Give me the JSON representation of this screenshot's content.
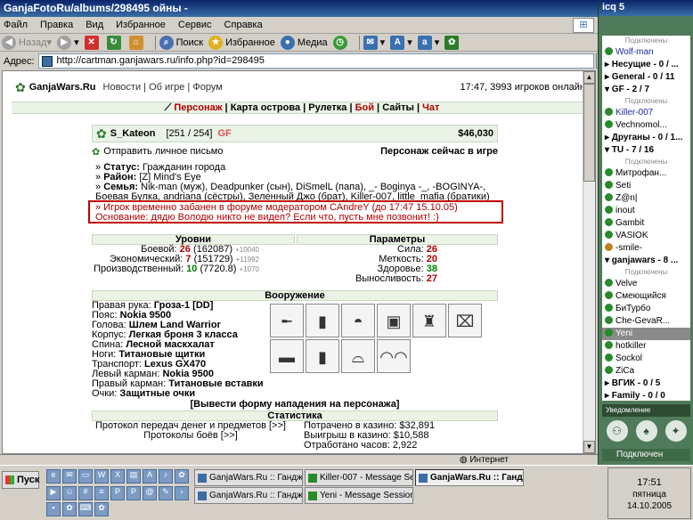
{
  "ie": {
    "title": "GanjaFotoRu/albums/298495",
    "title_suffix": " ойны -",
    "menu": [
      "Файл",
      "Правка",
      "Вид",
      "Избранное",
      "Сервис",
      "Справка"
    ],
    "toolbar": {
      "back": "Назад",
      "search": "Поиск",
      "favorites": "Избранное",
      "media": "Медиа"
    },
    "address_label": "Адрес:",
    "url": "http://cartman.ganjawars.ru/info.php?id=298495",
    "status_zone": "Интернет"
  },
  "site": {
    "brand": "GanjaWars.Ru",
    "nav": "Новости | Об игре | Форум",
    "online": "17:47, 3993 игроков онлайн",
    "nav2_person": "Персонаж",
    "nav2_map": "Карта острова",
    "nav2_roulette": "Рулетка",
    "nav2_fight": "Бой",
    "nav2_sites": "Сайты",
    "nav2_chat": "Чат"
  },
  "player": {
    "name": "S_Kateon",
    "hp": "[251 / 254]",
    "badge": "GF",
    "money": "$46,030",
    "send_mail": "Отправить личное письмо",
    "in_game": "Персонаж сейчас в игре",
    "status_label": "Статус:",
    "status": "Гражданин города",
    "district_label": "Район:",
    "district": "[Z] Mind's Eye",
    "family_label": "Семья:",
    "family": "Nik-man (муж), Deadpunker (сын), DiSmelL (папа), _- Boginya -_, -BOGINYA-, Боевая Булка, andriana (сёстры), Зеленный Джо (брат), Killer-007, little_mafia (братики)"
  },
  "ban": {
    "line1": "» Игрок временно забанен в форуме модератором CAndreY (до 17:47 15.10.05)",
    "line2": "Основание: дядю Володю никто не видел? Если что, пусть мне позвонит! :)"
  },
  "levels": {
    "title": "Уровни",
    "rows": [
      {
        "label": "Боевой:",
        "value": "26",
        "extra": "(162087)",
        "small": "+10040"
      },
      {
        "label": "Экономический:",
        "value": "7",
        "extra": "(151729)",
        "small": "+11992"
      },
      {
        "label": "Производственный:",
        "value": "10",
        "extra": "(7720.8)",
        "small": "+1070"
      }
    ]
  },
  "params": {
    "title": "Параметры",
    "rows": [
      {
        "label": "Сила:",
        "value": "26"
      },
      {
        "label": "Меткость:",
        "value": "20"
      },
      {
        "label": "Здоровье:",
        "value": "38"
      },
      {
        "label": "Выносливость:",
        "value": "27"
      }
    ]
  },
  "equipment": {
    "title": "Вооружение",
    "rows": [
      {
        "slot": "Правая рука:",
        "item": "Гроза-1 [DD]"
      },
      {
        "slot": "Пояс:",
        "item": "Nokia 9500"
      },
      {
        "slot": "Голова:",
        "item": "Шлем Land Warrior"
      },
      {
        "slot": "Корпус:",
        "item": "Легкая броня 3 класса"
      },
      {
        "slot": "Спина:",
        "item": "Лесной маскхалат"
      },
      {
        "slot": "Ноги:",
        "item": "Титановые щитки"
      },
      {
        "slot": "Транспорт:",
        "item": "Lexus GX470"
      },
      {
        "slot": "Левый карман:",
        "item": "Nokia 9500"
      },
      {
        "slot": "Правый карман:",
        "item": "Титановые вставки"
      },
      {
        "slot": "Очки:",
        "item": "Защитные очки"
      }
    ],
    "icons": [
      "rifle-icon",
      "phone-icon",
      "helmet-icon",
      "armor-icon",
      "camo-icon",
      "shin-guard-icon",
      "car-icon",
      "phone-icon",
      "insert-icon",
      "glasses-icon"
    ]
  },
  "attack_link": "[Вывести форму нападения на персонажа]",
  "stats": {
    "title": "Статистика",
    "left1": "Протокол передач денег и предметов [>>]",
    "left2": "Протоколы боёв [>>]",
    "right1": "Потрачено в казино: $32,891",
    "right2": "Выигрыш в казино: $10,588",
    "right3": "Отработано часов: 2,922"
  },
  "icq": {
    "title": "icq 5",
    "entries": [
      {
        "kind": "label",
        "text": "Подключены"
      },
      {
        "kind": "ct",
        "text": "Wolf-man",
        "cls": "blue"
      },
      {
        "kind": "grp",
        "text": "▸ Несущие - 0 / ..."
      },
      {
        "kind": "grp",
        "text": "▸ General - 0 / 11"
      },
      {
        "kind": "grp",
        "text": "▾ GF - 2 / 7"
      },
      {
        "kind": "label",
        "text": "Подключены"
      },
      {
        "kind": "ct",
        "text": "Killer-007",
        "cls": "blue"
      },
      {
        "kind": "ct",
        "text": "Vechnomol...",
        "cls": ""
      },
      {
        "kind": "grp",
        "text": "▸ Друганы - 0 / 1..."
      },
      {
        "kind": "grp",
        "text": "▾ TU - 7 / 16"
      },
      {
        "kind": "label",
        "text": "Подключены"
      },
      {
        "kind": "ct",
        "text": "Митрофан...",
        "cls": ""
      },
      {
        "kind": "ct",
        "text": "Seti",
        "cls": ""
      },
      {
        "kind": "ct",
        "text": "Z@n|",
        "cls": ""
      },
      {
        "kind": "ct",
        "text": "inout",
        "cls": ""
      },
      {
        "kind": "ct",
        "text": "Gambit",
        "cls": ""
      },
      {
        "kind": "ct",
        "text": "VASIOK",
        "cls": ""
      },
      {
        "kind": "ct",
        "text": "-smile-",
        "cls": "away"
      },
      {
        "kind": "grp",
        "text": "▾ ganjawars - 8 ..."
      },
      {
        "kind": "label",
        "text": "Подключены"
      },
      {
        "kind": "ct",
        "text": "Velve",
        "cls": ""
      },
      {
        "kind": "ct",
        "text": "Смеющийся",
        "cls": ""
      },
      {
        "kind": "ct",
        "text": "БиТурбо",
        "cls": ""
      },
      {
        "kind": "ct",
        "text": "Che-GevaR...",
        "cls": ""
      },
      {
        "kind": "ct",
        "text": "Yeni",
        "cls": "sel"
      },
      {
        "kind": "ct",
        "text": "hotkiller",
        "cls": ""
      },
      {
        "kind": "ct",
        "text": "Sockol",
        "cls": ""
      },
      {
        "kind": "ct",
        "text": "ZiCa",
        "cls": ""
      },
      {
        "kind": "grp",
        "text": "▸ ВГИК - 0 / 5"
      },
      {
        "kind": "grp",
        "text": "▸ Family - 0 / 0"
      }
    ],
    "notify": "Уведомление",
    "status": "Подключен"
  },
  "taskbar": {
    "start": "Пуск",
    "tasks": [
      {
        "label": "GanjaWars.Ru :: Гандж...",
        "active": false
      },
      {
        "label": "Killer-007 - Message Ses...",
        "active": false
      },
      {
        "label": "GanjaWars.Ru :: Гандж...",
        "active": true
      },
      {
        "label": "GanjaWars.Ru :: Гандж...",
        "active": false
      },
      {
        "label": "Yeni - Message Session (...",
        "active": false
      }
    ],
    "clock": "17:51",
    "weekday": "пятница",
    "date": "14.10.2005"
  }
}
